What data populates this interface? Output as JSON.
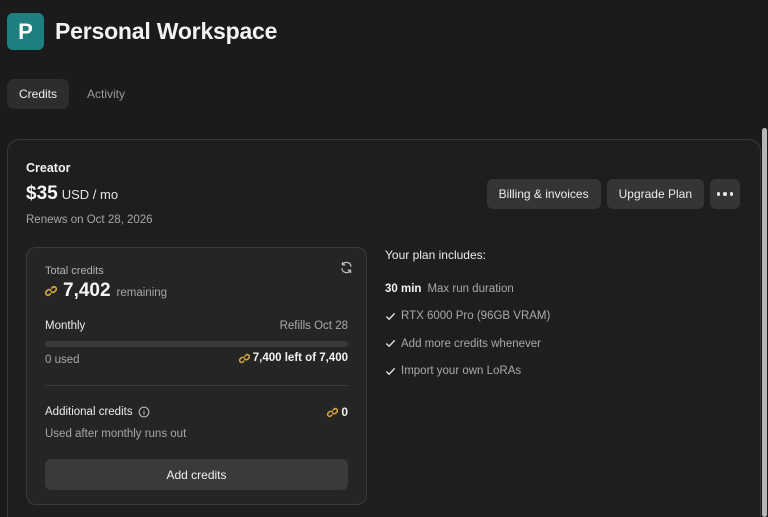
{
  "workspace": {
    "avatar_letter": "P",
    "title": "Personal Workspace"
  },
  "tabs": [
    {
      "label": "Credits",
      "active": true
    },
    {
      "label": "Activity",
      "active": false
    }
  ],
  "plan": {
    "name": "Creator",
    "price": "$35",
    "price_unit": "USD / mo",
    "renews": "Renews on Oct 28, 2026"
  },
  "actions": {
    "billing_label": "Billing & invoices",
    "upgrade_label": "Upgrade Plan",
    "more_icon": "more-horizontal-icon"
  },
  "credits": {
    "total_label": "Total credits",
    "total_value": "7,402",
    "remaining_label": "remaining",
    "monthly_label": "Monthly",
    "refills_label": "Refills Oct 28",
    "used_fraction": 0,
    "used_label": "0 used",
    "left_label": "7,400 left of 7,400",
    "additional_label": "Additional credits",
    "additional_value": "0",
    "additional_note": "Used after monthly runs out",
    "add_button_label": "Add credits",
    "refresh_icon": "refresh-icon",
    "coin_icon": "coin-link-icon"
  },
  "includes": {
    "title": "Your plan includes:",
    "run_duration_value": "30 min",
    "run_duration_label": "Max run duration",
    "items": [
      "RTX 6000 Pro (96GB VRAM)",
      "Add more credits whenever",
      "Import your own LoRAs"
    ]
  },
  "colors": {
    "accent_avatar": "#1e7f80",
    "coin": "#d4a93a",
    "background": "#1b1b1b"
  }
}
